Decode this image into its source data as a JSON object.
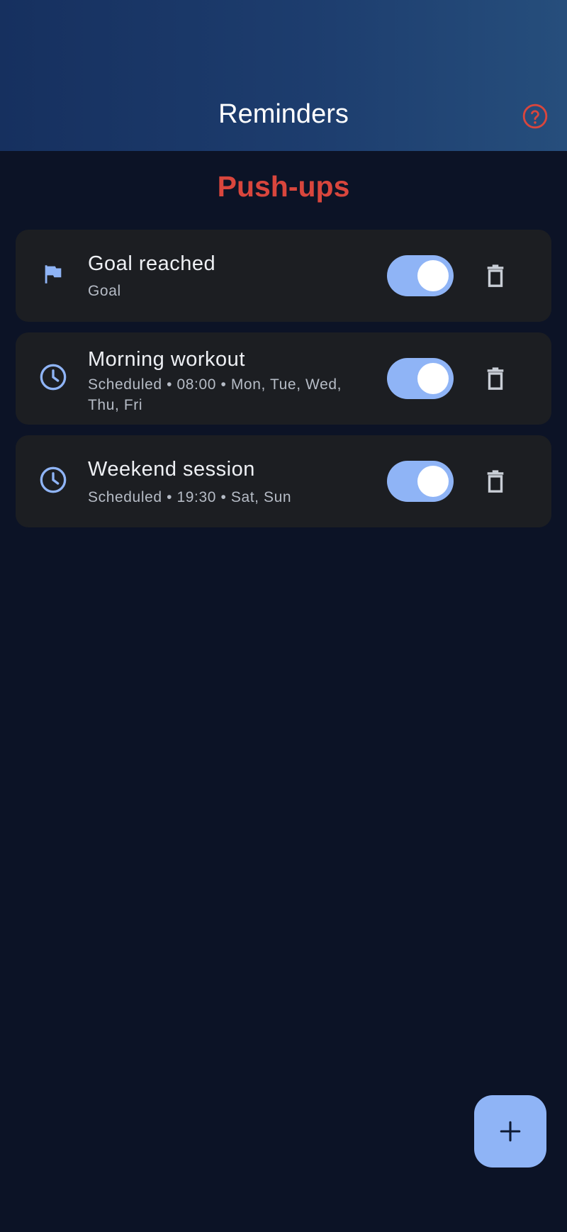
{
  "header": {
    "title": "Reminders",
    "help_icon": "help-circle-icon"
  },
  "section": {
    "title": "Push-ups"
  },
  "reminders": [
    {
      "title": "Goal reached",
      "subtitle": "Goal",
      "icon": "flag-icon",
      "enabled": true
    },
    {
      "title": "Morning workout",
      "subtitle": "Scheduled • 08:00 • Mon, Tue, Wed, Thu, Fri",
      "icon": "clock-icon",
      "enabled": true
    },
    {
      "title": "Weekend session",
      "subtitle": "Scheduled • 19:30 • Sat, Sun",
      "icon": "clock-icon",
      "enabled": true
    }
  ],
  "fab": {
    "icon": "plus-icon"
  },
  "colors": {
    "accent": "#8fb4f6",
    "section_title": "#d9463d",
    "card_bg": "#1c1e22",
    "background": "#0c1326"
  }
}
